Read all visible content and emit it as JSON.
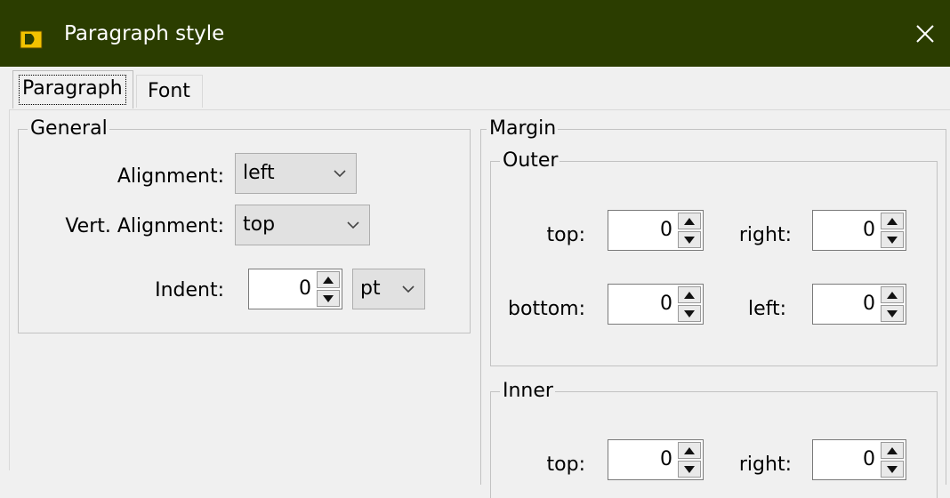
{
  "window": {
    "title": "Paragraph style",
    "icon": "app-icon",
    "close": "close-icon",
    "titlebar_color": "#2b3d00"
  },
  "tabs": [
    {
      "label": "Paragraph",
      "selected": true
    },
    {
      "label": "Font",
      "selected": false
    }
  ],
  "general": {
    "legend": "General",
    "alignment_label": "Alignment:",
    "alignment_value": "left",
    "vert_alignment_label": "Vert. Alignment:",
    "vert_alignment_value": "top",
    "indent_label": "Indent:",
    "indent_value": "0",
    "indent_unit": "pt"
  },
  "margin": {
    "legend": "Margin",
    "outer": {
      "legend": "Outer",
      "top_label": "top:",
      "top_value": "0",
      "right_label": "right:",
      "right_value": "0",
      "bottom_label": "bottom:",
      "bottom_value": "0",
      "left_label": "left:",
      "left_value": "0"
    },
    "inner": {
      "legend": "Inner",
      "top_label": "top:",
      "top_value": "0",
      "right_label": "right:",
      "right_value": "0"
    }
  }
}
